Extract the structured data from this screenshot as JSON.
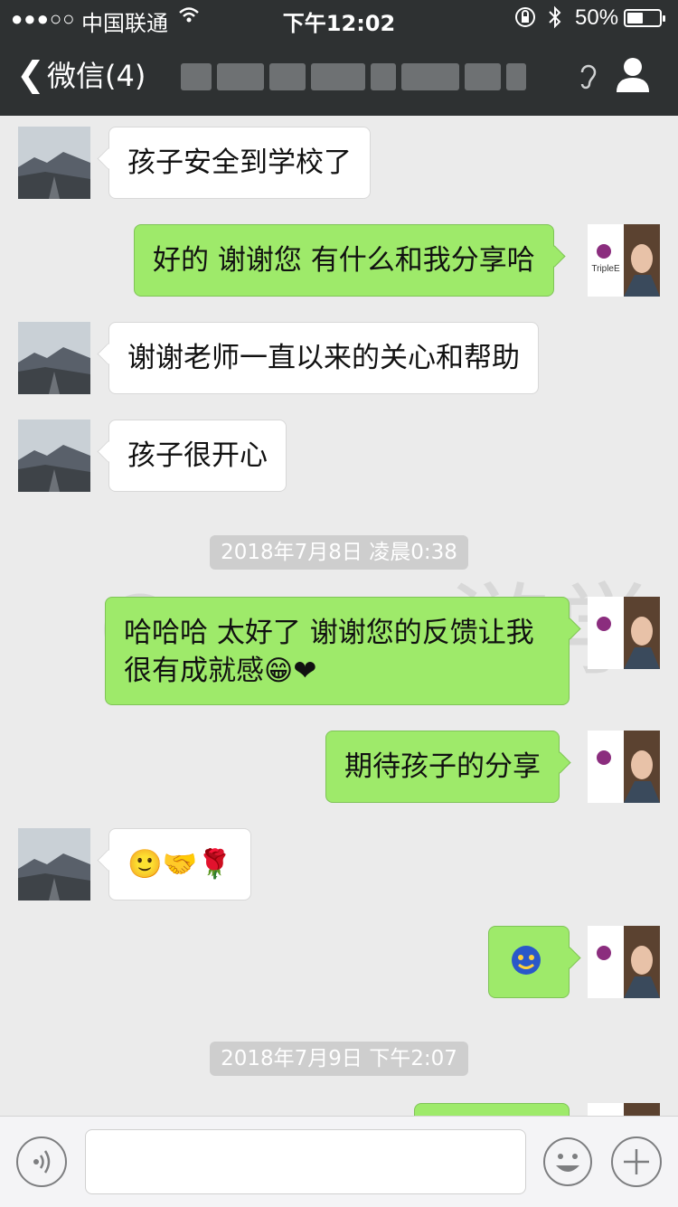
{
  "status_bar": {
    "signal": "●●●○○",
    "carrier": "中国联通",
    "time": "下午12:02",
    "battery_percent": "50%",
    "battery_level": 0.5
  },
  "nav": {
    "back_label": "微信(4)",
    "title_blurred": true
  },
  "watermark": "© 一一游学",
  "messages": [
    {
      "side": "in",
      "text": "孩子安全到学校了"
    },
    {
      "side": "out",
      "text": "好的 谢谢您 有什么和我分享哈"
    },
    {
      "side": "in",
      "text": "谢谢老师一直以来的关心和帮助"
    },
    {
      "side": "in",
      "text": "孩子很开心"
    },
    {
      "type": "time",
      "text": "2018年7月8日 凌晨0:38"
    },
    {
      "side": "out",
      "text": "哈哈哈 太好了 谢谢您的反馈让我很有成就感😁❤"
    },
    {
      "side": "out",
      "text": "期待孩子的分享"
    },
    {
      "side": "in",
      "text": "🙂🤝🌹"
    },
    {
      "side": "out",
      "text": "emoji"
    },
    {
      "type": "time",
      "text": "2018年7月9日 下午2:07"
    }
  ],
  "my_avatar_brand": "TripleE",
  "colors": {
    "nav_bg": "#2e3132",
    "chat_bg": "#ebebeb",
    "bubble_out": "#9eea6a",
    "bubble_in": "#ffffff"
  }
}
